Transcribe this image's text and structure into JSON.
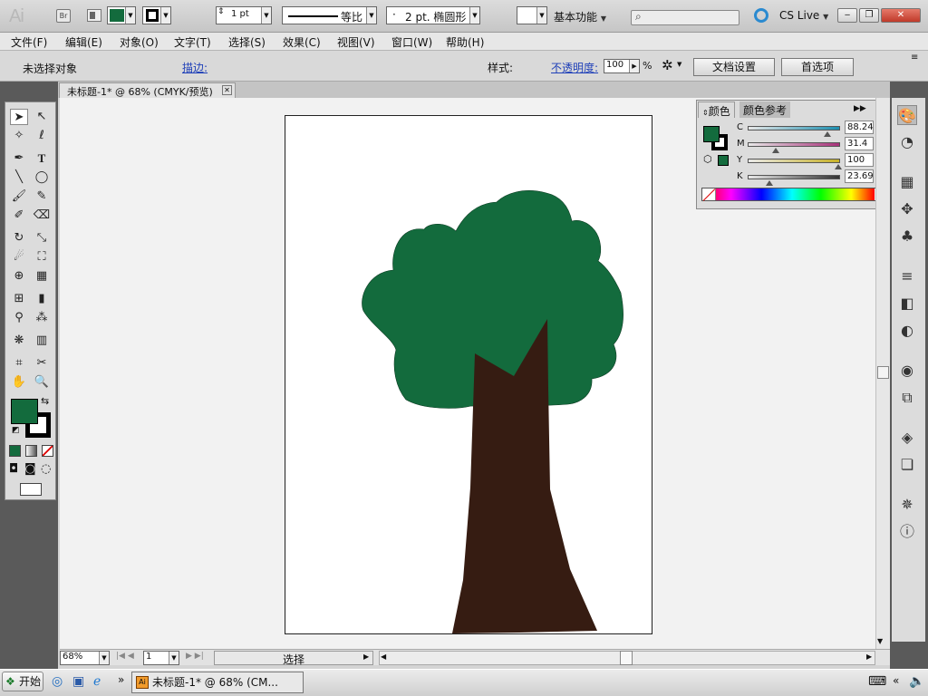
{
  "app": {
    "logo": "Ai",
    "bridge": "Br",
    "workspace": "基本功能",
    "cs_live": "CS Live"
  },
  "menu": [
    "文件(F)",
    "编辑(E)",
    "对象(O)",
    "文字(T)",
    "选择(S)",
    "效果(C)",
    "视图(V)",
    "窗口(W)",
    "帮助(H)"
  ],
  "control": {
    "selection_status": "未选择对象",
    "stroke_label": "描边:",
    "stroke_weight": "1 pt",
    "stroke_profile": "等比",
    "brush": "2 pt. 椭圆形",
    "brush_dot": "·",
    "style_label": "样式:",
    "opacity_label": "不透明度:",
    "opacity_value": "100",
    "pct": "%",
    "doc_setup": "文档设置",
    "prefs": "首选项",
    "fill_color": "#136b3d",
    "stroke_color": "#000000"
  },
  "doc_tab": "未标题-1* @ 68% (CMYK/预览)",
  "color_panel": {
    "tab_color": "颜色",
    "tab_guide": "颜色参考",
    "channels": [
      {
        "label": "C",
        "value": "88.24",
        "pos": 88.24,
        "color": "#1c8fb0"
      },
      {
        "label": "M",
        "value": "31.4",
        "pos": 31.4,
        "color": "#a8307a"
      },
      {
        "label": "Y",
        "value": "100",
        "pos": 100,
        "color": "#c7b126"
      },
      {
        "label": "K",
        "value": "23.69",
        "pos": 23.69,
        "color": "#333333"
      }
    ],
    "pct": "%"
  },
  "status": {
    "zoom": "68%",
    "page": "1",
    "tool": "选择"
  },
  "colors": {
    "foliage": "#136b3d",
    "trunk": "#361c12"
  },
  "taskbar": {
    "start": "开始",
    "task": "未标题-1* @ 68% (CM..."
  }
}
